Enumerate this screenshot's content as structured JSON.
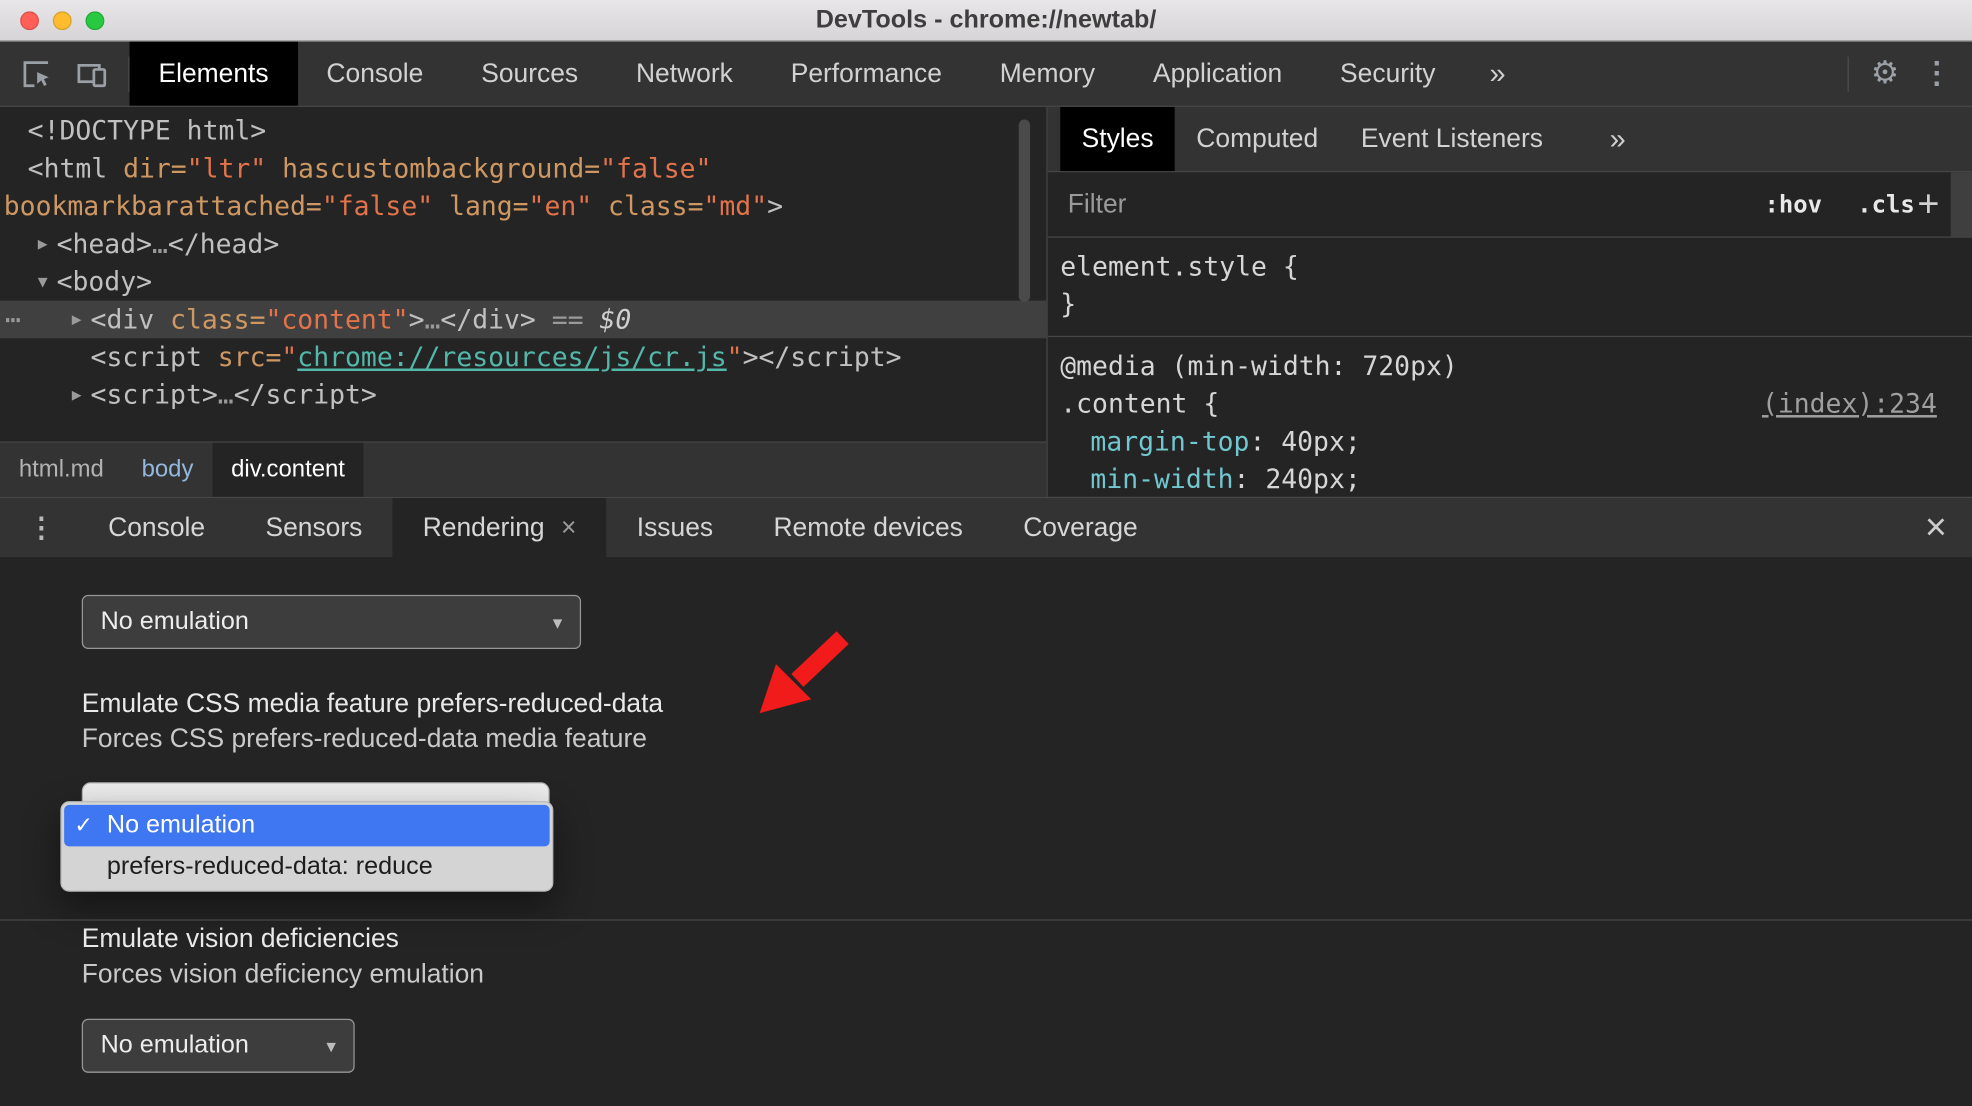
{
  "window": {
    "title": "DevTools - chrome://newtab/",
    "traffic_lights": [
      {
        "name": "close",
        "color": "#ff5f57"
      },
      {
        "name": "minimize",
        "color": "#febc2e"
      },
      {
        "name": "zoom",
        "color": "#28c840"
      }
    ]
  },
  "icons": {
    "gear": "⚙",
    "kebab": "⋮",
    "overflow": "»",
    "close": "×",
    "check": "✓",
    "dropdown": "▾",
    "ellipsis": "⋯",
    "drawer_kebab": "⋮"
  },
  "toolbar": {
    "tabs": [
      {
        "label": "Elements",
        "active": true
      },
      {
        "label": "Console"
      },
      {
        "label": "Sources"
      },
      {
        "label": "Network"
      },
      {
        "label": "Performance"
      },
      {
        "label": "Memory"
      },
      {
        "label": "Application"
      },
      {
        "label": "Security"
      }
    ],
    "more": "»"
  },
  "elements_panel": {
    "lines": [
      {
        "pad": 22,
        "tokens": [
          {
            "c": "tag",
            "t": "<!DOCTYPE html>"
          }
        ]
      },
      {
        "pad": 22,
        "tokens": [
          {
            "c": "tag",
            "t": "<html "
          },
          {
            "c": "attr",
            "t": "dir="
          },
          {
            "c": "val",
            "t": "\"ltr\""
          },
          {
            "c": "attr",
            "t": " hascustombackground="
          },
          {
            "c": "val",
            "t": "\"false\""
          }
        ]
      },
      {
        "pad": 3,
        "tokens": [
          {
            "c": "attr",
            "t": "bookmarkbarattached="
          },
          {
            "c": "val",
            "t": "\"false\""
          },
          {
            "c": "attr",
            "t": " lang="
          },
          {
            "c": "val",
            "t": "\"en\""
          },
          {
            "c": "attr",
            "t": " class="
          },
          {
            "c": "val",
            "t": "\"md\""
          },
          {
            "c": "tag",
            "t": ">"
          }
        ]
      },
      {
        "pad": 30,
        "tokens": [
          {
            "c": "arw",
            "t": "▶"
          },
          {
            "c": "tag",
            "t": "<head>"
          },
          {
            "c": "dim",
            "t": "…"
          },
          {
            "c": "tag",
            "t": "</head>"
          }
        ]
      },
      {
        "pad": 30,
        "tokens": [
          {
            "c": "arw",
            "t": "▼"
          },
          {
            "c": "tag",
            "t": "<body>"
          }
        ]
      },
      {
        "pad": 57,
        "selected": true,
        "gutter": "⋯",
        "tokens": [
          {
            "c": "arw",
            "t": "▶"
          },
          {
            "c": "tag",
            "t": "<div "
          },
          {
            "c": "attr",
            "t": "class="
          },
          {
            "c": "val",
            "t": "\"content\""
          },
          {
            "c": "tag",
            "t": ">"
          },
          {
            "c": "dim",
            "t": "…"
          },
          {
            "c": "tag",
            "t": "</div>"
          },
          {
            "c": "eq",
            "t": " == "
          },
          {
            "c": "dollar",
            "t": "$0"
          }
        ]
      },
      {
        "pad": 72,
        "tokens": [
          {
            "c": "tag",
            "t": "<script "
          },
          {
            "c": "attr",
            "t": "src="
          },
          {
            "c": "val",
            "t": "\""
          },
          {
            "c": "link",
            "t": "chrome://resources/js/cr.js"
          },
          {
            "c": "val",
            "t": "\""
          },
          {
            "c": "tag",
            "t": "></script>"
          }
        ]
      },
      {
        "pad": 57,
        "tokens": [
          {
            "c": "arw",
            "t": "▶"
          },
          {
            "c": "tag",
            "t": "<script>"
          },
          {
            "c": "dim",
            "t": "…"
          },
          {
            "c": "tag",
            "t": "</script>"
          }
        ]
      }
    ],
    "breadcrumbs": [
      {
        "label": "html.md"
      },
      {
        "label": "body",
        "accent": true
      },
      {
        "label": "div.content",
        "active": true
      }
    ]
  },
  "styles_panel": {
    "tabs": [
      {
        "label": "Styles",
        "active": true
      },
      {
        "label": "Computed"
      },
      {
        "label": "Event Listeners"
      }
    ],
    "more": "»",
    "filter_placeholder": "Filter",
    "hov": ":hov",
    "cls": ".cls",
    "plus": "+",
    "sections": [
      {
        "lines": [
          {
            "pad": 10,
            "tokens": [
              {
                "c": "plain",
                "t": "element.style {"
              }
            ]
          },
          {
            "pad": 10,
            "tokens": [
              {
                "c": "plain",
                "t": "}"
              }
            ]
          }
        ]
      },
      {
        "lines": [
          {
            "pad": 10,
            "tokens": [
              {
                "c": "plain",
                "t": "@media (min-width: 720px)"
              }
            ]
          },
          {
            "pad": 10,
            "link": "(index):234",
            "tokens": [
              {
                "c": "plain",
                "t": ".content {"
              }
            ]
          },
          {
            "pad": 34,
            "tokens": [
              {
                "c": "prop",
                "t": "margin-top"
              },
              {
                "c": "plain",
                "t": ": 40px;"
              }
            ]
          },
          {
            "pad": 34,
            "tokens": [
              {
                "c": "prop",
                "t": "min-width"
              },
              {
                "c": "plain",
                "t": ": 240px;"
              }
            ]
          }
        ]
      }
    ]
  },
  "drawer": {
    "kebab": "⋮",
    "close": "×",
    "tabs": [
      {
        "label": "Console"
      },
      {
        "label": "Sensors"
      },
      {
        "label": "Rendering",
        "active": true,
        "closable": true
      },
      {
        "label": "Issues"
      },
      {
        "label": "Remote devices"
      },
      {
        "label": "Coverage"
      }
    ],
    "rendering": {
      "top_select": {
        "value": "No emulation"
      },
      "reduced_data": {
        "title": "Emulate CSS media feature prefers-reduced-data",
        "desc": "Forces CSS prefers-reduced-data media feature"
      },
      "popup": {
        "options": [
          {
            "label": "No emulation",
            "checked": true,
            "highlighted": true
          },
          {
            "label": "prefers-reduced-data: reduce",
            "checked": false,
            "highlighted": false
          }
        ]
      },
      "vision": {
        "title": "Emulate vision deficiencies",
        "desc": "Forces vision deficiency emulation"
      },
      "bottom_select": {
        "value": "No emulation"
      }
    }
  },
  "annotation": {
    "arrow_color": "#f21b1b"
  }
}
